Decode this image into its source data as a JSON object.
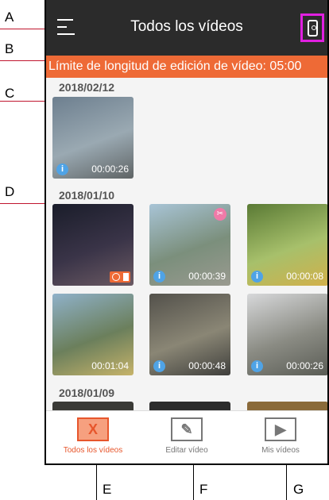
{
  "callouts": [
    "A",
    "B",
    "C",
    "D",
    "E",
    "F",
    "G"
  ],
  "header": {
    "title": "Todos los vídeos"
  },
  "banner": {
    "text": "Límite de longitud de edición de vídeo: 05:00"
  },
  "groups": [
    {
      "date": "2018/02/12",
      "videos": [
        {
          "duration": "00:00:26",
          "colors": [
            "#6d7f8f",
            "#9aa9b2",
            "#5f6465"
          ]
        }
      ]
    },
    {
      "date": "2018/01/10",
      "videos": [
        {
          "duration": "",
          "colors": [
            "#1a1d2a",
            "#3a3448",
            "#6b5a63"
          ]
        },
        {
          "duration": "00:00:39",
          "colors": [
            "#a8c4d6",
            "#7b8f7c",
            "#9a9a90"
          ]
        },
        {
          "duration": "00:00:08",
          "colors": [
            "#5a7a35",
            "#a7c06b",
            "#d2b04a"
          ]
        },
        {
          "duration": "00:01:04",
          "colors": [
            "#8fb1c9",
            "#6b7f5c",
            "#c6b36a"
          ]
        },
        {
          "duration": "00:00:48",
          "colors": [
            "#53514b",
            "#8a8675",
            "#3f3f3c"
          ]
        },
        {
          "duration": "00:00:26",
          "colors": [
            "#d7d8da",
            "#8a8b83",
            "#5a5c55"
          ]
        }
      ]
    },
    {
      "date": "2018/01/09",
      "videos": []
    }
  ],
  "tabs": [
    {
      "label": "Todos los vídeos",
      "symbol": "X",
      "active": true
    },
    {
      "label": "Editar vídeo",
      "symbol": "✎",
      "active": false
    },
    {
      "label": "Mis vídeos",
      "symbol": "▶",
      "active": false
    }
  ]
}
